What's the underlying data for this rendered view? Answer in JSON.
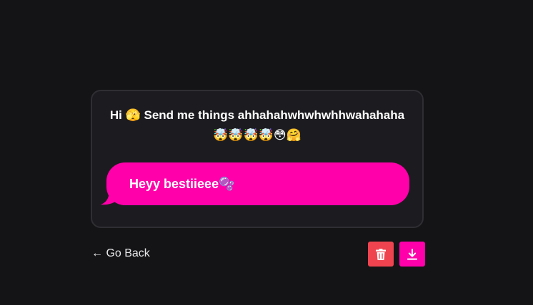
{
  "card": {
    "prompt": "Hi 🫣 Send me things ahhahahwhwhwhhwahahaha 🤯🤯🤯🤯😳🤗",
    "message": "Heyy bestiieee🫧"
  },
  "footer": {
    "back_label": "← Go Back",
    "delete_icon": "trash-icon",
    "download_icon": "download-icon"
  },
  "colors": {
    "background": "#141416",
    "card_background": "#1c1c20",
    "card_border": "#2e2e33",
    "bubble": "#ff00aa",
    "delete_button": "#ef4450",
    "download_button": "#ff00aa"
  }
}
